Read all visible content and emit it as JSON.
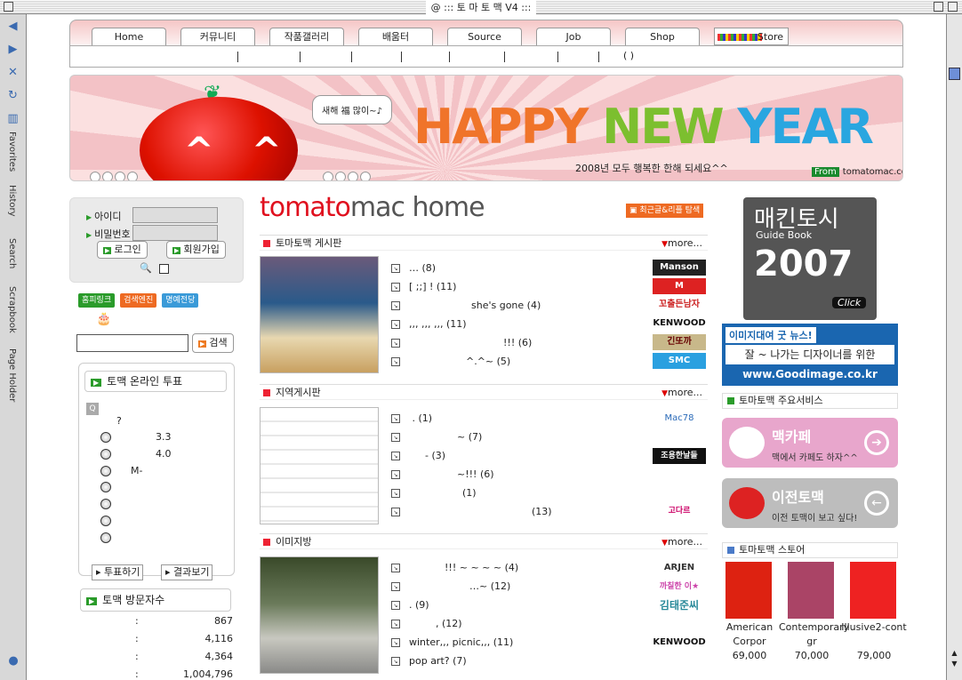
{
  "window": {
    "title": "@ ::: 토 마 토 맥 V4 :::"
  },
  "sidebar_tabs": [
    "Favorites",
    "History",
    "Search",
    "Scrapbook",
    "Page Holder"
  ],
  "nav": {
    "tabs": [
      "Home",
      "커뮤니티",
      "작품갤러리",
      "배움터",
      "Source",
      "Job",
      "Shop"
    ],
    "store_label": "Store",
    "subnav_paren": "(      )"
  },
  "banner": {
    "speech": "새해 福 많이~♪",
    "headline_1": "HAPPY",
    "headline_2": "NEW",
    "headline_3": "YEAR",
    "wish": "2008년 모두 행복한 한해 되세요^^",
    "from_label": "From",
    "site": "tomatomac.com"
  },
  "login": {
    "id_label": "아이디",
    "pw_label": "비밀번호",
    "login_btn": "로그인",
    "join_btn": "회원가입"
  },
  "engines": [
    "홈피링크",
    "검색엔진",
    "명예전당"
  ],
  "search": {
    "button": "검색"
  },
  "poll": {
    "title": "토맥 온라인 투표",
    "question": "?",
    "options": [
      "3.3",
      "4.0",
      "M-",
      "",
      "",
      "",
      ""
    ],
    "vote_btn": "투표하기",
    "result_btn": "결과보기"
  },
  "visitors": {
    "title": "토맥 방문자수",
    "counts": [
      "867",
      "4,116",
      "4,364",
      "1,004,796"
    ]
  },
  "main": {
    "brand_red": "tomato",
    "brand_dark": "mac",
    "brand_home": " home",
    "latest_btn": "최근글&리플 탐색",
    "more": "more...",
    "sections": [
      {
        "title": "토마토맥 게시판",
        "posts": [
          "… (8)",
          "[                           ;;]             ! (11)",
          "she's gone (4)",
          ",,,            ,,,                        ,,,      (11)",
          "!!! (6)",
          "^.^~ (5)"
        ],
        "logos": [
          "Manson",
          "M",
          "꼬출든남자",
          "KENWOOD",
          "긴또까",
          "SMC"
        ]
      },
      {
        "title": "지역게시판",
        "posts": [
          "                    .     (1)",
          "~ (7)",
          "- (3)",
          "~!!! (6)",
          "(1)",
          "(13)"
        ],
        "logos": [
          "Mac78",
          "",
          "조용한날들",
          "",
          "",
          "고다르"
        ]
      },
      {
        "title": "이미지방",
        "posts": [
          "!!!    ~    ~    ~    ~ (4)",
          "…~ (12)",
          ". (9)",
          ",             (12)",
          "winter,,, picnic,,, (11)",
          "pop art? (7)"
        ],
        "logos": [
          "ARJEN",
          "까칠한 이★",
          "김태준씨",
          "",
          "KENWOOD",
          ""
        ]
      }
    ]
  },
  "right": {
    "guide_k": "매킨토시",
    "guide_sub": "Guide Book",
    "guide_year": "2007",
    "guide_click": "Click",
    "good_title": "이미지대여 굿 뉴스!",
    "good_msg": "잘 ~ 나가는 디자이너를 위한",
    "good_url": "www.Goodimage.co.kr",
    "services_head": "토마토맥 주요서비스",
    "svc1_title": "맥카페",
    "svc1_sub": "맥에서 카페도 하자^^",
    "svc2_title": "이전토맥",
    "svc2_sub": "이전 토맥이 보고 싶다!",
    "store_head": "토마토맥 스토어",
    "books": [
      {
        "title": "American Corpor",
        "price": "69,000"
      },
      {
        "title": "Contemporary gr",
        "price": "70,000"
      },
      {
        "title": "Illusive2-cont",
        "price": "79,000"
      }
    ]
  },
  "colors": {
    "accent_red": "#e0101e",
    "accent_green": "#2a9b2a",
    "accent_orange": "#ee6a22",
    "accent_blue": "#1a66b0"
  }
}
